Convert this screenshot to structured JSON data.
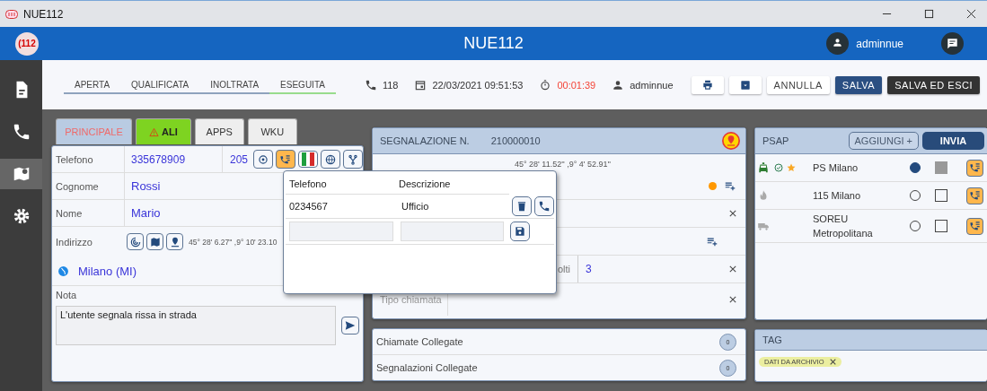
{
  "window": {
    "title": "NUE112"
  },
  "header": {
    "logo": "(112",
    "title": "NUE112",
    "user": "adminnue"
  },
  "sidebar": {
    "items": [
      {
        "kind": "document",
        "selected": false
      },
      {
        "kind": "phone",
        "selected": false
      },
      {
        "kind": "map",
        "selected": true
      },
      {
        "kind": "settings",
        "selected": false
      }
    ]
  },
  "toolbar": {
    "steps": [
      {
        "label": "APERTA",
        "selected": false
      },
      {
        "label": "QUALIFICATA",
        "selected": false
      },
      {
        "label": "INOLTRATA",
        "selected": false
      },
      {
        "label": "ESEGUITA",
        "selected": true
      }
    ],
    "call_number": "118",
    "datetime": "22/03/2021 09:51:53",
    "timer": "00:01:39",
    "operator": "adminnue",
    "buttons": [
      {
        "kind": "print"
      },
      {
        "kind": "archive"
      },
      {
        "kind": "outline",
        "label": "ANNULLA"
      },
      {
        "kind": "primary",
        "label": "SALVA"
      },
      {
        "kind": "dark",
        "label": "SALVA ED ESCI"
      }
    ]
  },
  "tabs": [
    {
      "label": "PRINCIPALE",
      "kind": "primary",
      "selected": false
    },
    {
      "label": "ALI",
      "kind": "warning",
      "selected": true
    },
    {
      "label": "APPS",
      "kind": "plain",
      "selected": false
    },
    {
      "label": "WKU",
      "kind": "plain",
      "selected": false
    }
  ],
  "ali": {
    "phone_label": "Telefono",
    "phone": "335678909",
    "extension": "205",
    "fields": [
      {
        "label": "Cognome",
        "value": "Rossi"
      },
      {
        "label": "Nome",
        "value": "Mario"
      }
    ],
    "address_label": "Indirizzo",
    "coordinates": "45° 28' 6.27'' ,9° 10' 23.10",
    "city": "Milano (MI)",
    "note_label": "Nota",
    "note": "L'utente segnala rissa in strada"
  },
  "popup": {
    "columns": [
      "Telefono",
      "Descrizione"
    ],
    "rows": [
      {
        "phone": "0234567",
        "description": "Ufficio"
      }
    ]
  },
  "report": {
    "title": "SEGNALAZIONE N.",
    "number": "210000010",
    "coordinates": "45° 28' 11.52'' ,9° 4' 52.91''",
    "count_label": "olti",
    "count": "3",
    "type_label": "Tipo chiamata"
  },
  "linked": [
    {
      "label": "Chiamate Collegate",
      "count": "0"
    },
    {
      "label": "Segnalazioni Collegate",
      "count": "0"
    }
  ],
  "psap": {
    "title": "PSAP",
    "add_button": "AGGIUNGI +",
    "send_button": "INVIA",
    "rows": [
      {
        "kind": "car",
        "name": "PS Milano",
        "verified": true,
        "starred": true,
        "selected": true,
        "checked": true
      },
      {
        "kind": "fire",
        "name": "115 Milano",
        "verified": false,
        "starred": false,
        "selected": false,
        "checked": false
      },
      {
        "kind": "truck",
        "name": "SOREU Metropolitana",
        "verified": false,
        "starred": false,
        "selected": false,
        "checked": false
      }
    ]
  },
  "tag": {
    "title": "TAG",
    "tags": [
      "DATI DA ARCHIVIO"
    ]
  }
}
